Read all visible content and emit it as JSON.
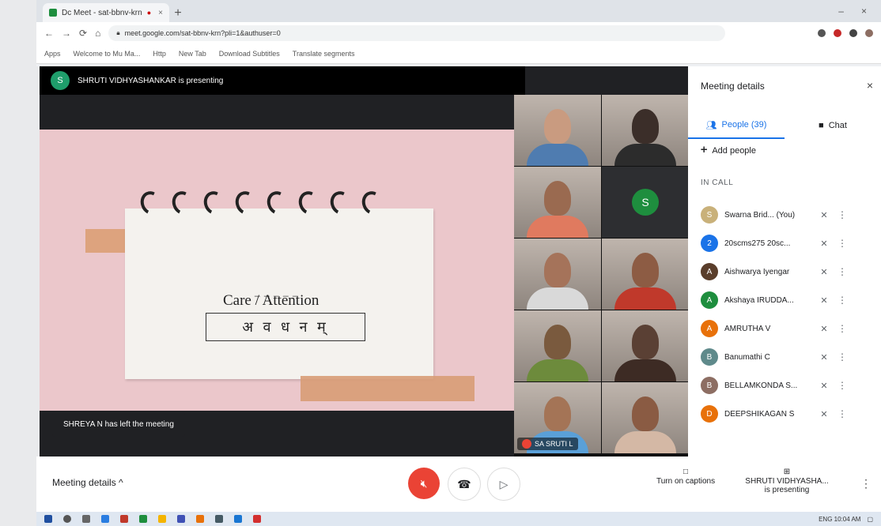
{
  "browser": {
    "tab_title": "Dc Meet - sat-bbnv-krn",
    "tab_dot": "●",
    "tab_close": "×",
    "new_tab": "+",
    "win_min": "–",
    "win_close": "×",
    "back": "←",
    "forward": "→",
    "reload": "⟳",
    "home": "⌂",
    "url": "meet.google.com/sat-bbnv-krn?pli=1&authuser=0",
    "bookmarks": [
      "Apps",
      "Welcome to Mu Ma...",
      "Http",
      "New Tab",
      "Download Subtitles",
      "Translate segments"
    ]
  },
  "presenter_bar": {
    "avatar_letter": "S",
    "text": "SHRUTI VIDHYASHANKAR is presenting"
  },
  "slide": {
    "dashes": "_ _ _ _ _",
    "word": "Care / Attention",
    "sanskrit": "अ व ध न म्"
  },
  "toast": "SHREYA N has left the meeting",
  "video_tiles": [
    {
      "type": "camera",
      "skin": "#c99b80",
      "shirt": "#4f7cb0"
    },
    {
      "type": "camera",
      "skin": "#3b2e29",
      "shirt": "#2c2c2c"
    },
    {
      "type": "camera",
      "skin": "#9a6a50",
      "shirt": "#e07a5f"
    },
    {
      "type": "avatar",
      "letter": "S"
    },
    {
      "type": "camera",
      "skin": "#a5735a",
      "shirt": "#d9d9d9"
    },
    {
      "type": "camera",
      "skin": "#8d5c44",
      "shirt": "#c0392b"
    },
    {
      "type": "camera",
      "skin": "#7a5a3e",
      "shirt": "#6d8b3c"
    },
    {
      "type": "camera",
      "skin": "#5a4034",
      "shirt": "#3d2b24"
    },
    {
      "type": "camera",
      "skin": "#a47456",
      "shirt": "#5aa0d8",
      "name": "SA SRUTI L"
    },
    {
      "type": "camera",
      "skin": "#8a5b43",
      "shirt": "#d4b8a5"
    }
  ],
  "panel": {
    "title": "Meeting details",
    "close": "×",
    "people_tab": "People (39)",
    "chat_tab": "Chat",
    "add_people": "Add people",
    "in_call": "IN CALL",
    "participants": [
      {
        "name": "Swarna Brid... (You)",
        "color": "#c9b17a",
        "letter": "S",
        "mic": "✕"
      },
      {
        "name": "20scms275 20sc...",
        "color": "#1a73e8",
        "letter": "2",
        "mic": "✕"
      },
      {
        "name": "Aishwarya Iyengar",
        "color": "#5a3e2b",
        "letter": "A",
        "mic": "✕"
      },
      {
        "name": "Akshaya IRUDDA...",
        "color": "#1e8e3e",
        "letter": "A",
        "mic": "✕"
      },
      {
        "name": "AMRUTHA V",
        "color": "#e8710a",
        "letter": "A",
        "mic": "✕"
      },
      {
        "name": "Banumathi C",
        "color": "#5f8a8b",
        "letter": "B",
        "mic": "✕"
      },
      {
        "name": "BELLAMKONDA S...",
        "color": "#8d6e63",
        "letter": "B",
        "mic": "✕"
      },
      {
        "name": "DEEPSHIKAGAN S",
        "color": "#e8710a",
        "letter": "D",
        "mic": "✕"
      }
    ]
  },
  "bottom": {
    "meeting_details": "Meeting details ^",
    "captions": "Turn on captions",
    "presenting": "SHRUTI VIDHYASHA... is presenting",
    "more": "⋮"
  },
  "taskbar": {
    "tray_text": "ENG 10:04 AM"
  },
  "colors": {
    "end_call": "#ea4335",
    "accent": "#1a73e8",
    "slide_bg": "#ebc7cb"
  }
}
